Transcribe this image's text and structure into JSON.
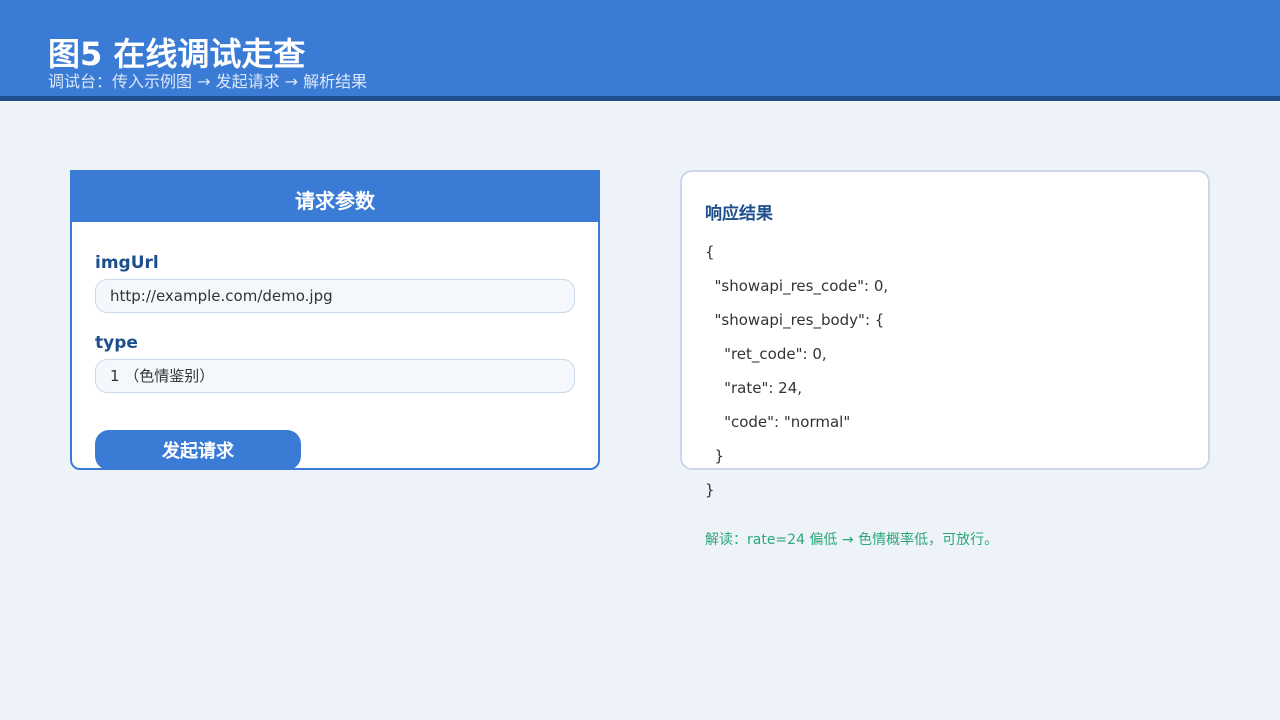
{
  "header": {
    "title": "图5  在线调试走查",
    "subtitle": "调试台：传入示例图 → 发起请求 → 解析结果"
  },
  "request": {
    "title": "请求参数",
    "fields": [
      {
        "label": "imgUrl",
        "value": "http://example.com/demo.jpg"
      },
      {
        "label": "type",
        "value": "1  （色情鉴别）"
      }
    ],
    "submit_label": "发起请求"
  },
  "response": {
    "title": "响应结果",
    "lines": [
      "{",
      "  \"showapi_res_code\": 0,",
      "  \"showapi_res_body\": {",
      "    \"ret_code\": 0,",
      "    \"rate\": 24,",
      "    \"code\": \"normal\"",
      "  }",
      "}"
    ],
    "interpretation": "解读：rate=24 偏低 → 色情概率低，可放行。"
  },
  "colors": {
    "accent": "#3a7bd5",
    "accent_dark": "#1d4f8c",
    "background": "#eef3fa",
    "success": "#2aa876"
  }
}
